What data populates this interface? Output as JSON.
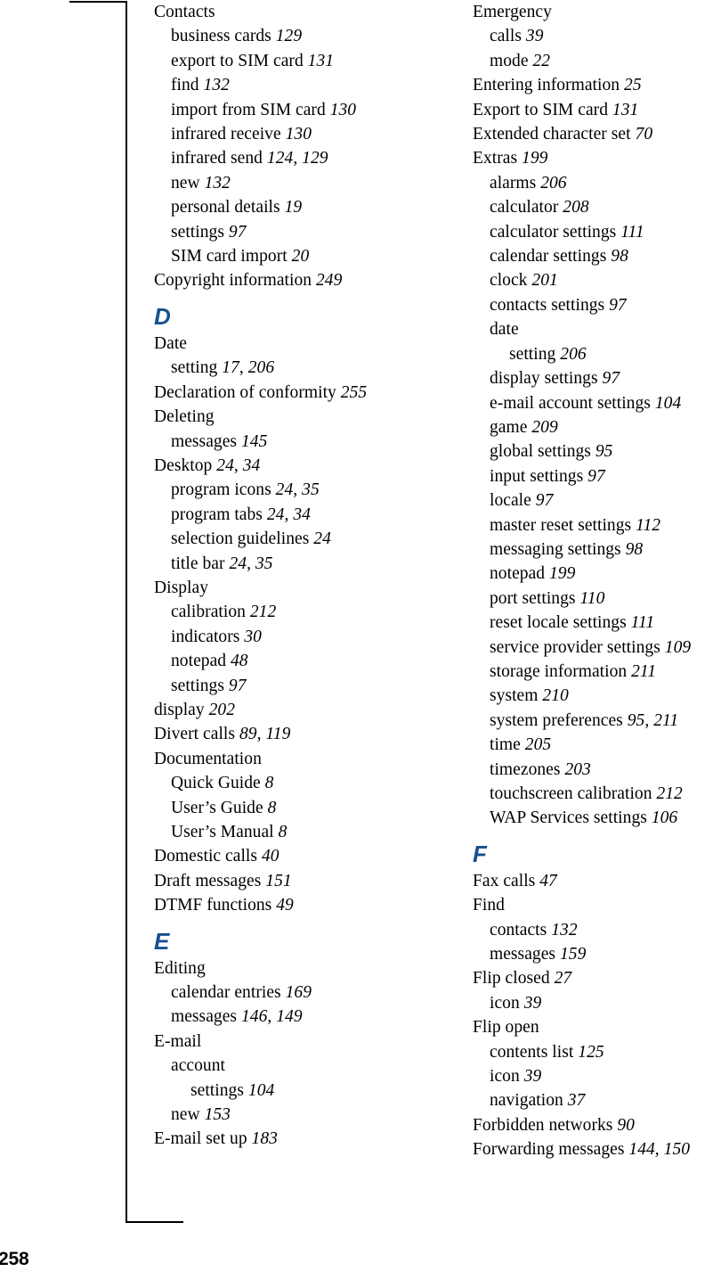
{
  "page": {
    "folio": "258",
    "document_type": "index",
    "accent_color": "#16508F",
    "text_color": "#000000",
    "background_color": "#FFFFFF"
  },
  "columns": [
    {
      "name": "left-column",
      "blocks": [
        {
          "type": "entry",
          "level": 0,
          "term": "Contacts",
          "pages": []
        },
        {
          "type": "entry",
          "level": 1,
          "term": "business cards",
          "pages": [
            "129"
          ]
        },
        {
          "type": "entry",
          "level": 1,
          "term": "export to SIM card",
          "pages": [
            "131"
          ]
        },
        {
          "type": "entry",
          "level": 1,
          "term": "find",
          "pages": [
            "132"
          ]
        },
        {
          "type": "entry",
          "level": 1,
          "term": "import from SIM card",
          "pages": [
            "130"
          ]
        },
        {
          "type": "entry",
          "level": 1,
          "term": "infrared receive",
          "pages": [
            "130"
          ]
        },
        {
          "type": "entry",
          "level": 1,
          "term": "infrared send",
          "pages": [
            "124",
            "129"
          ]
        },
        {
          "type": "entry",
          "level": 1,
          "term": "new",
          "pages": [
            "132"
          ]
        },
        {
          "type": "entry",
          "level": 1,
          "term": "personal details",
          "pages": [
            "19"
          ]
        },
        {
          "type": "entry",
          "level": 1,
          "term": "settings",
          "pages": [
            "97"
          ]
        },
        {
          "type": "entry",
          "level": 1,
          "term": "SIM card import",
          "pages": [
            "20"
          ]
        },
        {
          "type": "entry",
          "level": 0,
          "term": "Copyright information",
          "pages": [
            "249"
          ]
        },
        {
          "type": "letter",
          "letter": "D"
        },
        {
          "type": "entry",
          "level": 0,
          "term": "Date",
          "pages": []
        },
        {
          "type": "entry",
          "level": 1,
          "term": "setting",
          "pages": [
            "17",
            "206"
          ]
        },
        {
          "type": "entry",
          "level": 0,
          "term": "Declaration of conformity",
          "pages": [
            "255"
          ]
        },
        {
          "type": "entry",
          "level": 0,
          "term": "Deleting",
          "pages": []
        },
        {
          "type": "entry",
          "level": 1,
          "term": "messages",
          "pages": [
            "145"
          ]
        },
        {
          "type": "entry",
          "level": 0,
          "term": "Desktop",
          "pages": [
            "24",
            "34"
          ]
        },
        {
          "type": "entry",
          "level": 1,
          "term": "program icons",
          "pages": [
            "24",
            "35"
          ]
        },
        {
          "type": "entry",
          "level": 1,
          "term": "program tabs",
          "pages": [
            "24",
            "34"
          ]
        },
        {
          "type": "entry",
          "level": 1,
          "term": "selection guidelines",
          "pages": [
            "24"
          ]
        },
        {
          "type": "entry",
          "level": 1,
          "term": "title bar",
          "pages": [
            "24",
            "35"
          ]
        },
        {
          "type": "entry",
          "level": 0,
          "term": "Display",
          "pages": []
        },
        {
          "type": "entry",
          "level": 1,
          "term": "calibration",
          "pages": [
            "212"
          ]
        },
        {
          "type": "entry",
          "level": 1,
          "term": "indicators",
          "pages": [
            "30"
          ]
        },
        {
          "type": "entry",
          "level": 1,
          "term": "notepad",
          "pages": [
            "48"
          ]
        },
        {
          "type": "entry",
          "level": 1,
          "term": "settings",
          "pages": [
            "97"
          ]
        },
        {
          "type": "entry",
          "level": 0,
          "term": "display",
          "pages": [
            "202"
          ]
        },
        {
          "type": "entry",
          "level": 0,
          "term": "Divert calls",
          "pages": [
            "89",
            "119"
          ]
        },
        {
          "type": "entry",
          "level": 0,
          "term": "Documentation",
          "pages": []
        },
        {
          "type": "entry",
          "level": 1,
          "term": "Quick Guide",
          "pages": [
            "8"
          ]
        },
        {
          "type": "entry",
          "level": 1,
          "term": "User’s Guide",
          "pages": [
            "8"
          ]
        },
        {
          "type": "entry",
          "level": 1,
          "term": "User’s Manual",
          "pages": [
            "8"
          ]
        },
        {
          "type": "entry",
          "level": 0,
          "term": "Domestic calls",
          "pages": [
            "40"
          ]
        },
        {
          "type": "entry",
          "level": 0,
          "term": "Draft messages",
          "pages": [
            "151"
          ]
        },
        {
          "type": "entry",
          "level": 0,
          "term": "DTMF functions",
          "pages": [
            "49"
          ]
        },
        {
          "type": "letter",
          "letter": "E"
        },
        {
          "type": "entry",
          "level": 0,
          "term": "Editing",
          "pages": []
        },
        {
          "type": "entry",
          "level": 1,
          "term": "calendar entries",
          "pages": [
            "169"
          ]
        },
        {
          "type": "entry",
          "level": 1,
          "term": "messages",
          "pages": [
            "146",
            "149"
          ]
        },
        {
          "type": "entry",
          "level": 0,
          "term": "E-mail",
          "pages": []
        },
        {
          "type": "entry",
          "level": 1,
          "term": "account",
          "pages": []
        },
        {
          "type": "entry",
          "level": 2,
          "term": "settings",
          "pages": [
            "104"
          ]
        },
        {
          "type": "entry",
          "level": 1,
          "term": "new",
          "pages": [
            "153"
          ]
        },
        {
          "type": "entry",
          "level": 0,
          "term": "E-mail set up",
          "pages": [
            "183"
          ]
        }
      ]
    },
    {
      "name": "right-column",
      "blocks": [
        {
          "type": "entry",
          "level": 0,
          "term": "Emergency",
          "pages": []
        },
        {
          "type": "entry",
          "level": 1,
          "term": "calls",
          "pages": [
            "39"
          ]
        },
        {
          "type": "entry",
          "level": 1,
          "term": "mode",
          "pages": [
            "22"
          ]
        },
        {
          "type": "entry",
          "level": 0,
          "term": "Entering information",
          "pages": [
            "25"
          ]
        },
        {
          "type": "entry",
          "level": 0,
          "term": "Export to SIM card",
          "pages": [
            "131"
          ]
        },
        {
          "type": "entry",
          "level": 0,
          "term": "Extended character set",
          "pages": [
            "70"
          ]
        },
        {
          "type": "entry",
          "level": 0,
          "term": "Extras",
          "pages": [
            "199"
          ]
        },
        {
          "type": "entry",
          "level": 1,
          "term": "alarms",
          "pages": [
            "206"
          ]
        },
        {
          "type": "entry",
          "level": 1,
          "term": "calculator",
          "pages": [
            "208"
          ]
        },
        {
          "type": "entry",
          "level": 1,
          "term": "calculator settings",
          "pages": [
            "111"
          ]
        },
        {
          "type": "entry",
          "level": 1,
          "term": "calendar settings",
          "pages": [
            "98"
          ]
        },
        {
          "type": "entry",
          "level": 1,
          "term": "clock",
          "pages": [
            "201"
          ]
        },
        {
          "type": "entry",
          "level": 1,
          "term": "contacts settings",
          "pages": [
            "97"
          ]
        },
        {
          "type": "entry",
          "level": 1,
          "term": "date",
          "pages": []
        },
        {
          "type": "entry",
          "level": 2,
          "term": "setting",
          "pages": [
            "206"
          ]
        },
        {
          "type": "entry",
          "level": 1,
          "term": "display settings",
          "pages": [
            "97"
          ]
        },
        {
          "type": "entry",
          "level": 1,
          "term": "e-mail account settings",
          "pages": [
            "104"
          ]
        },
        {
          "type": "entry",
          "level": 1,
          "term": "game",
          "pages": [
            "209"
          ]
        },
        {
          "type": "entry",
          "level": 1,
          "term": "global settings",
          "pages": [
            "95"
          ]
        },
        {
          "type": "entry",
          "level": 1,
          "term": "input settings",
          "pages": [
            "97"
          ]
        },
        {
          "type": "entry",
          "level": 1,
          "term": "locale",
          "pages": [
            "97"
          ]
        },
        {
          "type": "entry",
          "level": 1,
          "term": "master reset settings",
          "pages": [
            "112"
          ]
        },
        {
          "type": "entry",
          "level": 1,
          "term": "messaging settings",
          "pages": [
            "98"
          ]
        },
        {
          "type": "entry",
          "level": 1,
          "term": "notepad",
          "pages": [
            "199"
          ]
        },
        {
          "type": "entry",
          "level": 1,
          "term": "port settings",
          "pages": [
            "110"
          ]
        },
        {
          "type": "entry",
          "level": 1,
          "term": "reset locale settings",
          "pages": [
            "111"
          ]
        },
        {
          "type": "entry",
          "level": 1,
          "term": "service provider settings",
          "pages": [
            "109"
          ]
        },
        {
          "type": "entry",
          "level": 1,
          "term": "storage information",
          "pages": [
            "211"
          ]
        },
        {
          "type": "entry",
          "level": 1,
          "term": "system",
          "pages": [
            "210"
          ]
        },
        {
          "type": "entry",
          "level": 1,
          "term": "system preferences",
          "pages": [
            "95",
            "211"
          ]
        },
        {
          "type": "entry",
          "level": 1,
          "term": "time",
          "pages": [
            "205"
          ]
        },
        {
          "type": "entry",
          "level": 1,
          "term": "timezones",
          "pages": [
            "203"
          ]
        },
        {
          "type": "entry",
          "level": 1,
          "term": "touchscreen calibration",
          "pages": [
            "212"
          ]
        },
        {
          "type": "entry",
          "level": 1,
          "term": "WAP Services settings",
          "pages": [
            "106"
          ]
        },
        {
          "type": "letter",
          "letter": "F"
        },
        {
          "type": "entry",
          "level": 0,
          "term": "Fax calls",
          "pages": [
            "47"
          ]
        },
        {
          "type": "entry",
          "level": 0,
          "term": "Find",
          "pages": []
        },
        {
          "type": "entry",
          "level": 1,
          "term": "contacts",
          "pages": [
            "132"
          ]
        },
        {
          "type": "entry",
          "level": 1,
          "term": "messages",
          "pages": [
            "159"
          ]
        },
        {
          "type": "entry",
          "level": 0,
          "term": "Flip closed",
          "pages": [
            "27"
          ]
        },
        {
          "type": "entry",
          "level": 1,
          "term": "icon",
          "pages": [
            "39"
          ]
        },
        {
          "type": "entry",
          "level": 0,
          "term": "Flip open",
          "pages": []
        },
        {
          "type": "entry",
          "level": 1,
          "term": "contents list",
          "pages": [
            "125"
          ]
        },
        {
          "type": "entry",
          "level": 1,
          "term": "icon",
          "pages": [
            "39"
          ]
        },
        {
          "type": "entry",
          "level": 1,
          "term": "navigation",
          "pages": [
            "37"
          ]
        },
        {
          "type": "entry",
          "level": 0,
          "term": "Forbidden networks",
          "pages": [
            "90"
          ]
        },
        {
          "type": "entry",
          "level": 0,
          "term": "Forwarding messages",
          "pages": [
            "144",
            "150"
          ]
        }
      ]
    }
  ]
}
